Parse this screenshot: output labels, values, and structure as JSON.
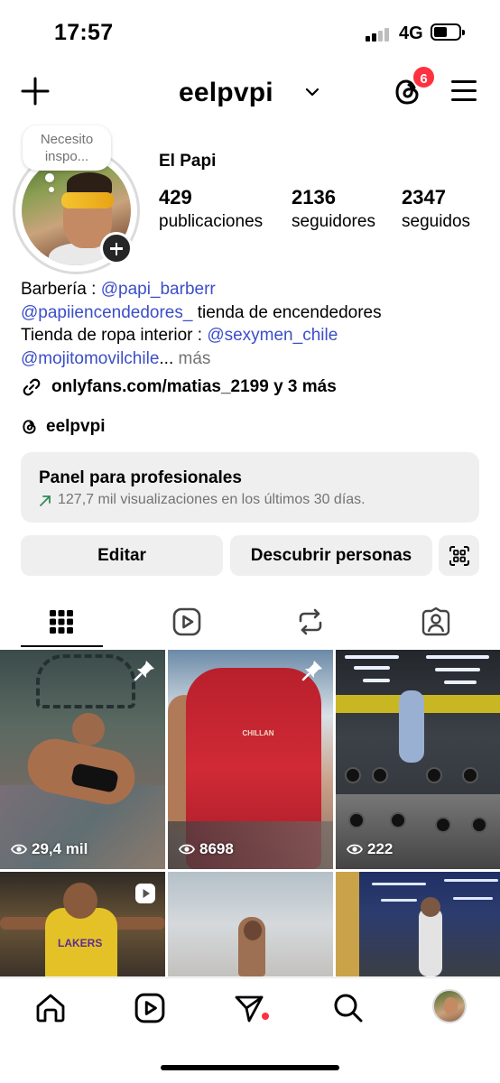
{
  "status_bar": {
    "time": "17:57",
    "network": "4G"
  },
  "header": {
    "username": "eelpvpi",
    "threads_badge": "6",
    "icons": [
      "plus-icon",
      "chevron-down-icon",
      "threads-icon",
      "menu-icon"
    ]
  },
  "profile": {
    "note_line1": "Necesito",
    "note_line2": "inspo...",
    "full_name": "El Papi",
    "stats": [
      {
        "value": "429",
        "label": "publicaciones"
      },
      {
        "value": "2136",
        "label": "seguidores"
      },
      {
        "value": "2347",
        "label": "seguidos"
      }
    ]
  },
  "bio": {
    "line1_text": "Barbería : ",
    "line1_mention": "@papi_barberr",
    "line2_mention": "@papiiencendedores_",
    "line2_text": " tienda de encendedores",
    "line3_text": "Tienda de ropa interior : ",
    "line3_mention": "@sexymen_chile",
    "line4_mention": "@mojitomovilchile",
    "line4_ellipsis": "...",
    "line4_more": " más",
    "link": "onlyfans.com/matias_2199 y 3 más",
    "threads_handle": "eelpvpi"
  },
  "pro_panel": {
    "title": "Panel para profesionales",
    "subtitle": "127,7 mil visualizaciones en los últimos 30 días."
  },
  "buttons": {
    "edit": "Editar",
    "discover": "Descubrir personas"
  },
  "tabs": [
    "grid-icon",
    "reels-icon",
    "reposts-icon",
    "tagged-icon"
  ],
  "posts": [
    {
      "views": "29,4 mil",
      "pinned": true
    },
    {
      "views": "8698",
      "pinned": true
    },
    {
      "views": "222",
      "pinned": false
    },
    {
      "views": "",
      "reel": true
    },
    {
      "views": ""
    },
    {
      "views": ""
    }
  ],
  "bottom_nav": [
    "home-icon",
    "reels-icon",
    "messages-icon",
    "search-icon",
    "profile-avatar"
  ],
  "colors": {
    "mention": "#3b4ec8",
    "badge": "#ff3040",
    "muted": "#737373",
    "panel_bg": "#efefef"
  }
}
